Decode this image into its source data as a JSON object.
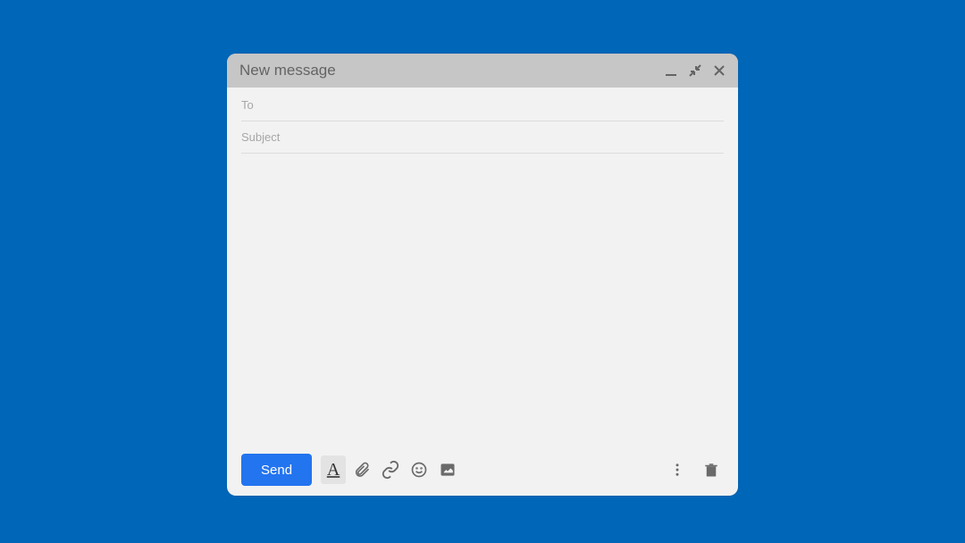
{
  "header": {
    "title": "New message"
  },
  "fields": {
    "to_placeholder": "To",
    "to_value": "",
    "subject_placeholder": "Subject",
    "subject_value": ""
  },
  "body": {
    "value": ""
  },
  "footer": {
    "send_label": "Send",
    "format_letter": "A"
  },
  "colors": {
    "background": "#0067B8",
    "send_button": "#2374ef"
  }
}
